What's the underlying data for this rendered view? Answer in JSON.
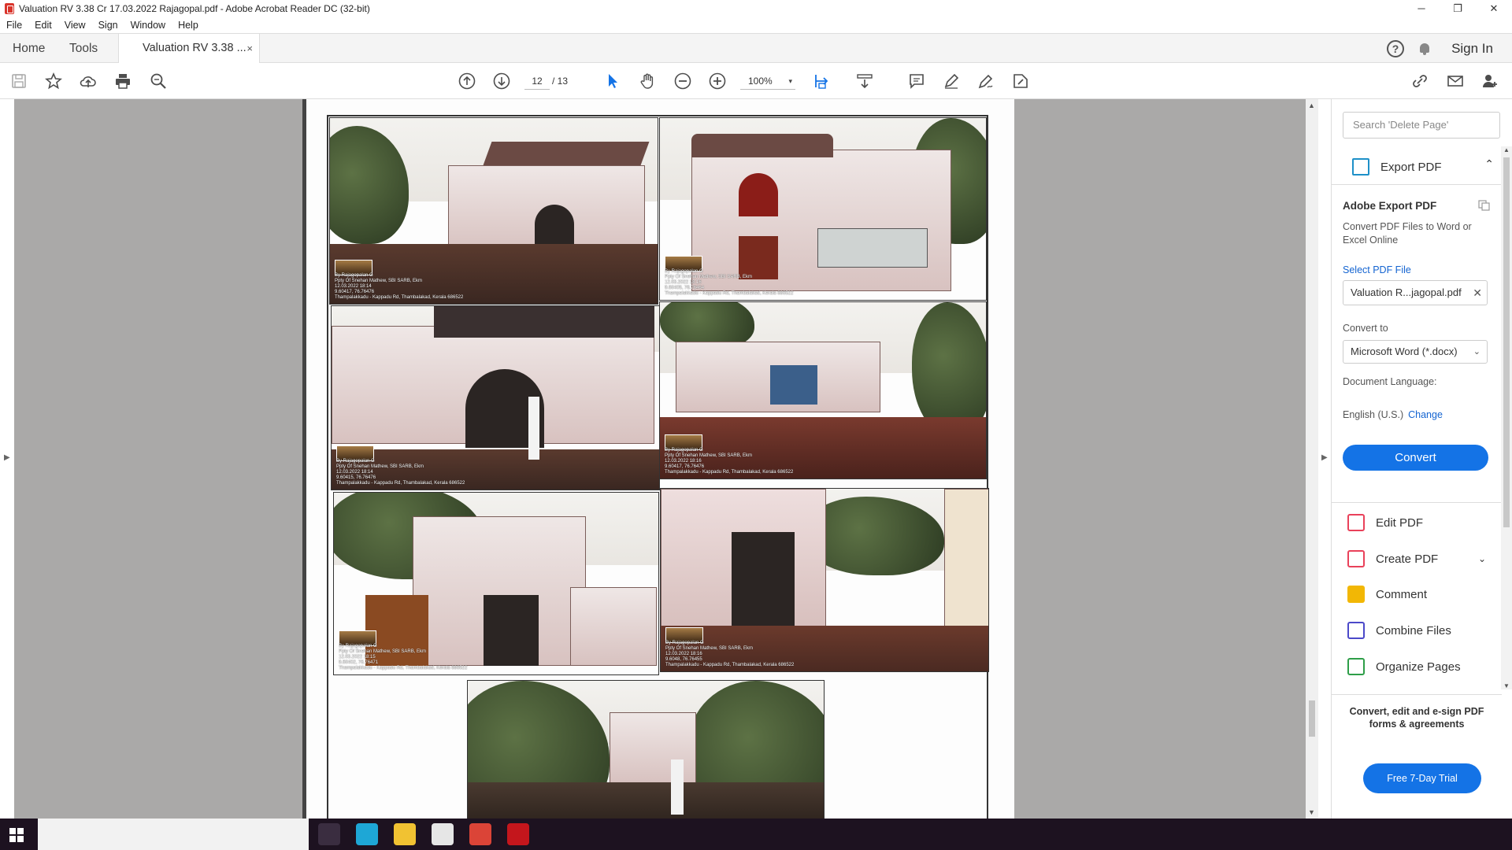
{
  "window": {
    "title": "Valuation RV 3.38 Cr 17.03.2022 Rajagopal.pdf - Adobe Acrobat Reader DC (32-bit)",
    "controls": [
      "─",
      "❐",
      "✕"
    ]
  },
  "menu": [
    "File",
    "Edit",
    "View",
    "Sign",
    "Window",
    "Help"
  ],
  "tabs": {
    "home": "Home",
    "tools": "Tools",
    "document": "Valuation RV 3.38 ...",
    "close": "×"
  },
  "header_right": {
    "help": "?",
    "sign_in": "Sign In"
  },
  "toolbar": {
    "current_page": "12",
    "total_pages": "/ 13",
    "zoom": "100%",
    "zoom_caret": "▾"
  },
  "document": {
    "photos": [
      {
        "caption": "By Rajagopalan G\nPpty Of Snehan Mathew, SBI SARB, Ekm\n12.03.2022 18:14\n9.60417, 76.76476\nThampalakkadu - Kappadu Rd, Thambalakad, Kerala 686522"
      },
      {
        "caption": "By Rajagopalan G\nPpty Of Snehan Mathew, SBI SARB, Ekm\n12.03.2022 18:16\n9.60405, 76.76464\nThampalakkadu - Kappadu Rd, Thambalakad, Kerala 686522"
      },
      {
        "caption": "By Rajagopalan G\nPpty Of Snehan Mathew, SBI SARB, Ekm\n12.03.2022 18:14\n9.60415, 76.76476\nThampalakkadu - Kappadu Rd, Thambalakad, Kerala 686522"
      },
      {
        "caption": "By Rajagopalan G\nPpty Of Snehan Mathew, SBI SARB, Ekm\n12.03.2022 18:16\n9.60417, 76.76476\nThampalakkadu - Kappadu Rd, Thambalakad, Kerala 686522"
      },
      {
        "caption": "By Rajagopalan G\nPpty Of Snehan Mathew, SBI SARB, Ekm\n12.03.2022 18:15\n9.60402, 76.76471\nThampalakkadu - Kappadu Rd, Thambalakad, Kerala 686522"
      },
      {
        "caption": "By Rajagopalan G\nPpty Of Snehan Mathew, SBI SARB, Ekm\n12.03.2022 18:16\n9.6048, 76.76455\nThampalakkadu - Kappadu Rd, Thambalakad, Kerala 686522"
      },
      {
        "caption": ""
      }
    ]
  },
  "sidebar": {
    "search_placeholder": "Search 'Delete Page'",
    "export_title": "Export PDF",
    "export_chevron": "⌃",
    "panel_title": "Adobe Export PDF",
    "panel_desc": "Convert PDF Files to Word or Excel Online",
    "select_file_link": "Select PDF File",
    "selected_file": "Valuation R...jagopal.pdf",
    "file_remove": "✕",
    "convert_to_label": "Convert to",
    "convert_to_value": "Microsoft Word (*.docx)",
    "doc_language_label": "Document Language:",
    "doc_language_value": "English (U.S.)",
    "change_link": "Change",
    "convert_button": "Convert",
    "tools": [
      {
        "label": "Edit PDF",
        "color": "#e9415a"
      },
      {
        "label": "Create PDF",
        "color": "#e9415a",
        "chevron": "⌄"
      },
      {
        "label": "Comment",
        "color": "#f2b705"
      },
      {
        "label": "Combine Files",
        "color": "#4b49c9"
      },
      {
        "label": "Organize Pages",
        "color": "#2e9e48"
      }
    ],
    "promo_text": "Convert, edit and e-sign PDF forms & agreements",
    "trial_button": "Free 7-Day Trial"
  },
  "colors": {
    "accent": "#1473e6",
    "viewer_bg": "#aaa9a8",
    "taskbar": "#1d1220"
  }
}
